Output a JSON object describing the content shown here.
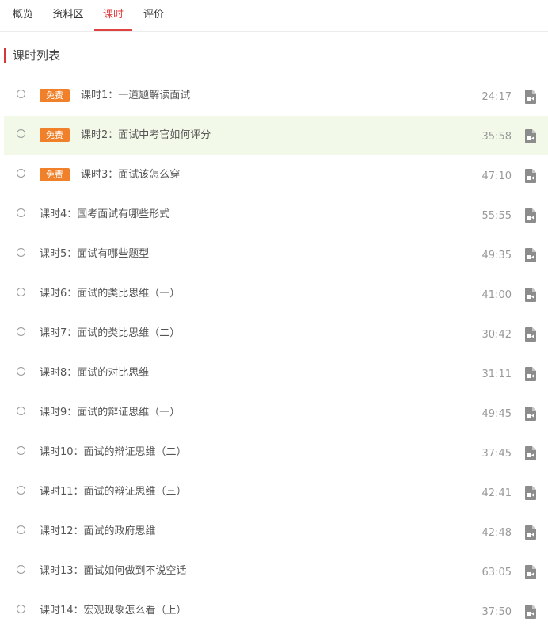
{
  "tabs": [
    {
      "label": "概览",
      "active": false
    },
    {
      "label": "资料区",
      "active": false
    },
    {
      "label": "课时",
      "active": true
    },
    {
      "label": "评价",
      "active": false
    }
  ],
  "section_title": "课时列表",
  "free_badge": "免费",
  "file_icon": "video-file-icon",
  "colors": {
    "accent": "#e04141",
    "badge": "#f0812a",
    "highlight_row": "#f2f9e8",
    "icon": "#8c8c8c"
  },
  "lessons": [
    {
      "title": "课时1：一道题解读面试",
      "duration": "24:17",
      "free": true,
      "highlight": false
    },
    {
      "title": "课时2：面试中考官如何评分",
      "duration": "35:58",
      "free": true,
      "highlight": true
    },
    {
      "title": "课时3：面试该怎么穿",
      "duration": "47:10",
      "free": true,
      "highlight": false
    },
    {
      "title": "课时4：国考面试有哪些形式",
      "duration": "55:55",
      "free": false,
      "highlight": false
    },
    {
      "title": "课时5：面试有哪些题型",
      "duration": "49:35",
      "free": false,
      "highlight": false
    },
    {
      "title": "课时6：面试的类比思维（一）",
      "duration": "41:00",
      "free": false,
      "highlight": false
    },
    {
      "title": "课时7：面试的类比思维（二）",
      "duration": "30:42",
      "free": false,
      "highlight": false
    },
    {
      "title": "课时8：面试的对比思维",
      "duration": "31:11",
      "free": false,
      "highlight": false
    },
    {
      "title": "课时9：面试的辩证思维（一）",
      "duration": "49:45",
      "free": false,
      "highlight": false
    },
    {
      "title": "课时10：面试的辩证思维（二）",
      "duration": "37:45",
      "free": false,
      "highlight": false
    },
    {
      "title": "课时11：面试的辩证思维（三）",
      "duration": "42:41",
      "free": false,
      "highlight": false
    },
    {
      "title": "课时12：面试的政府思维",
      "duration": "42:48",
      "free": false,
      "highlight": false
    },
    {
      "title": "课时13：面试如何做到不说空话",
      "duration": "63:05",
      "free": false,
      "highlight": false
    },
    {
      "title": "课时14：宏观现象怎么看（上）",
      "duration": "37:50",
      "free": false,
      "highlight": false
    }
  ]
}
